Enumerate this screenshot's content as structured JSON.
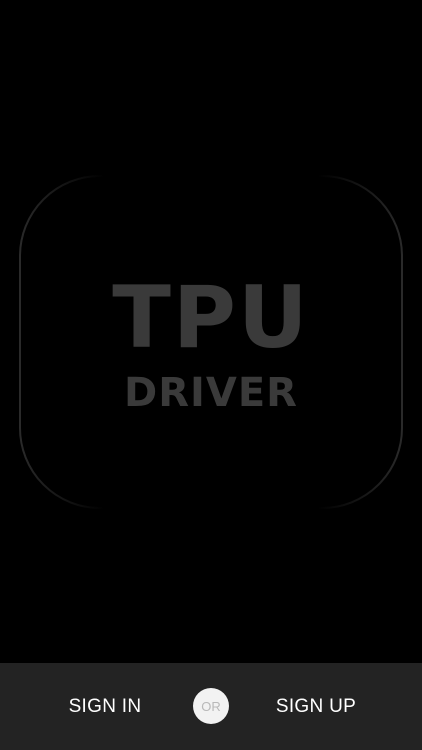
{
  "logo": {
    "title": "TPU",
    "subtitle": "DRIVER"
  },
  "auth_bar": {
    "sign_in_label": "SIGN IN",
    "separator_label": "OR",
    "sign_up_label": "SIGN UP"
  },
  "colors": {
    "background": "#000000",
    "logo_text": "#3a3a3a",
    "bottom_bar": "#232323",
    "button_text": "#ffffff",
    "or_badge_bg": "#f2f2f2",
    "or_badge_text": "#b9b9b9"
  }
}
